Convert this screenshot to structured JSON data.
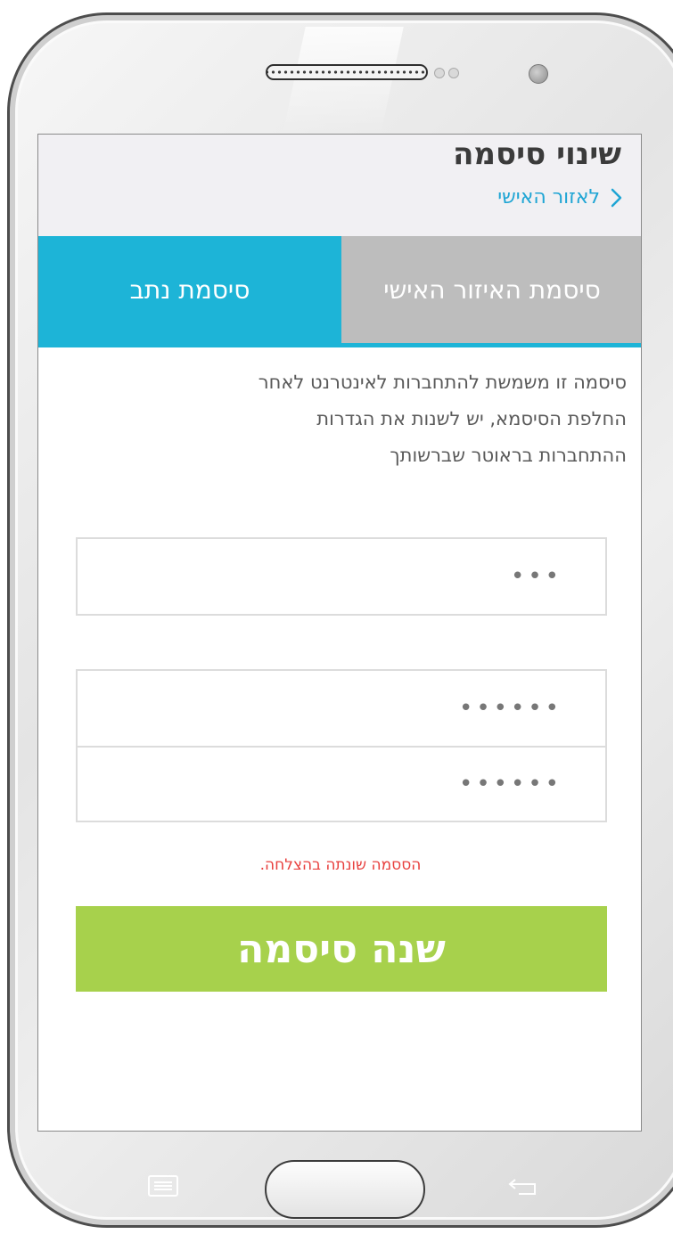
{
  "header": {
    "title": "שינוי סיסמה",
    "back_link_label": "לאזור האישי"
  },
  "tabs": [
    {
      "label": "סיסמת האיזור האישי",
      "active": false
    },
    {
      "label": "סיסמת נתב",
      "active": true
    }
  ],
  "description": {
    "lines": [
      "סיסמה זו משמשת להתחברות לאינטרנט לאחר",
      "החלפת הסיסמא, יש לשנות את הגדרות",
      "ההתחברות בראוטר שברשותך"
    ]
  },
  "form": {
    "current_password_value": "•••",
    "new_password_value": "••••••",
    "confirm_password_value": "••••••",
    "success_message": "הססמה שונתה בהצלחה.",
    "submit_label": "שנה סיסמה"
  },
  "colors": {
    "accent_blue": "#1db4d7",
    "link_blue": "#1fa5d4",
    "inactive_tab": "#bdbdbd",
    "submit_green": "#a7d14c",
    "success_red": "#e8403e"
  },
  "icons": {
    "back": "chevron-right-icon",
    "speaker": "speaker-grille-icon",
    "camera": "front-camera-icon",
    "menu": "menu-key-icon",
    "back_key": "back-key-icon"
  }
}
